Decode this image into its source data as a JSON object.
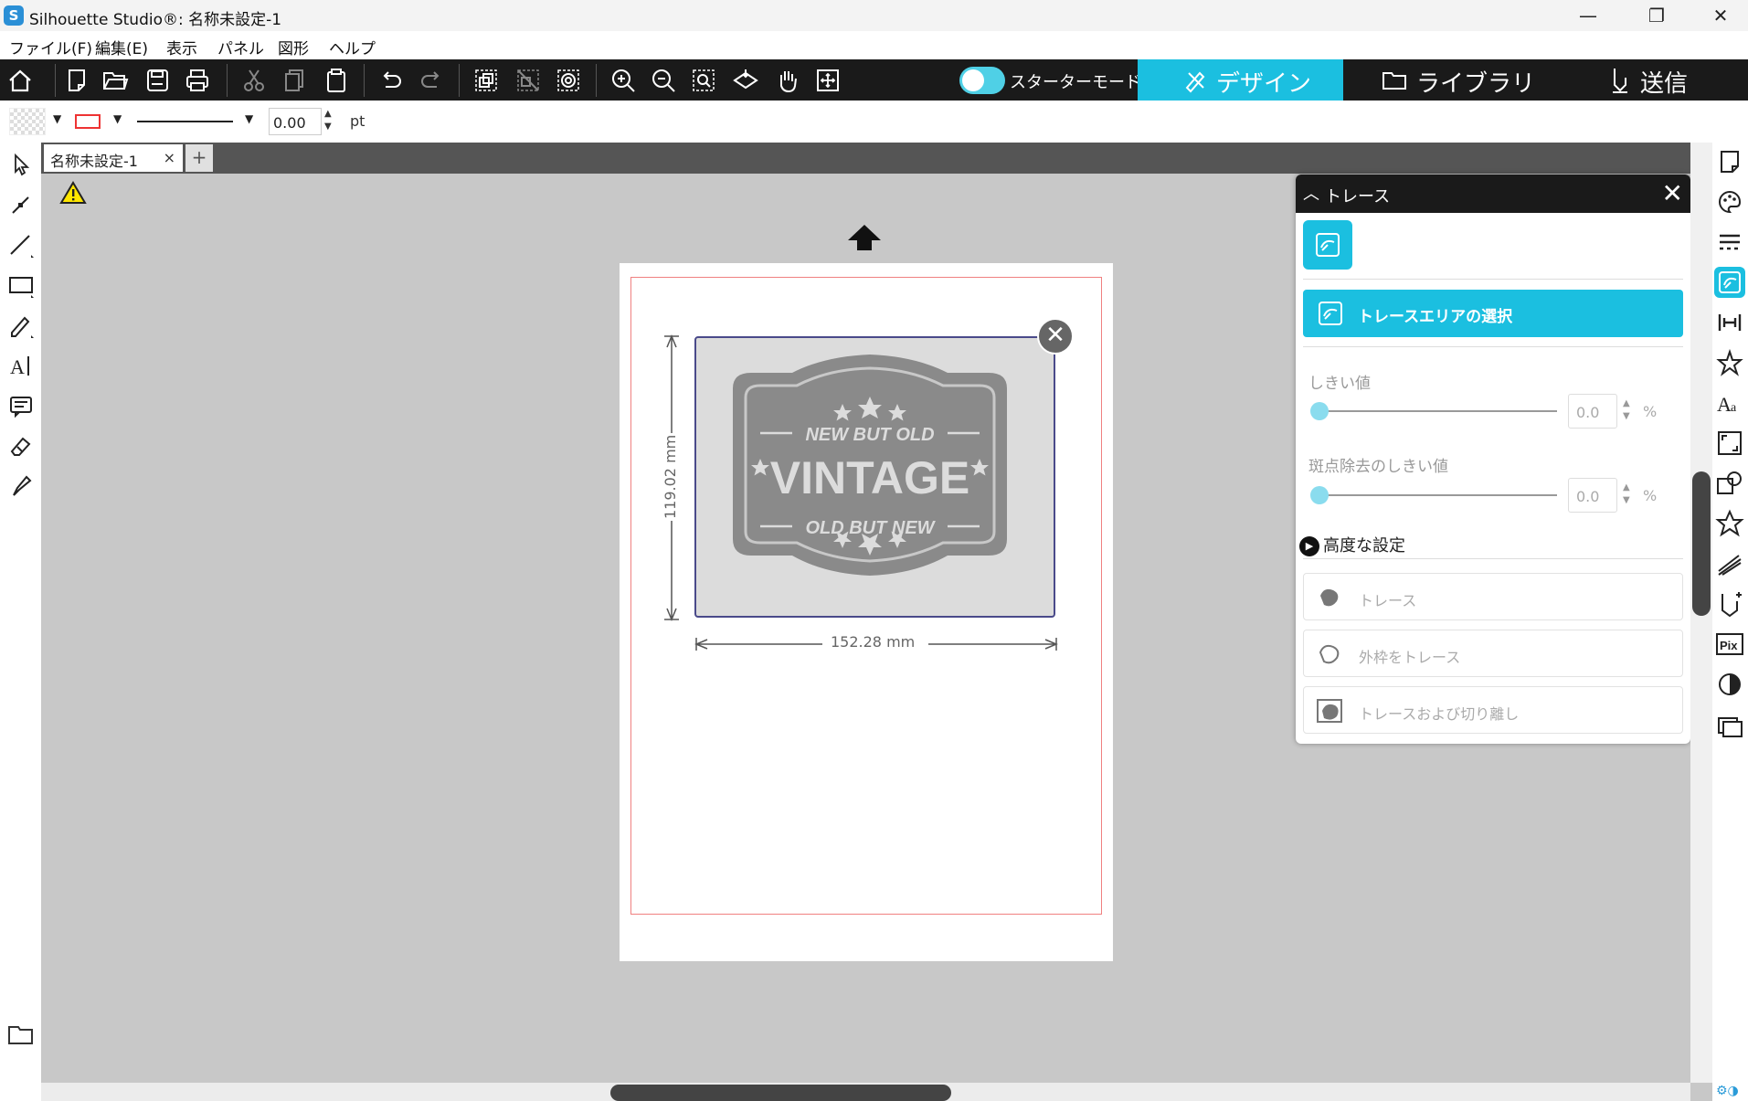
{
  "window": {
    "title": "Silhouette Studio®: 名称未設定-1",
    "minimize": "—",
    "restore": "❐",
    "close": "✕"
  },
  "menu": [
    "ファイル(F)",
    "編集(E)",
    "表示",
    "パネル",
    "図形",
    "ヘルプ"
  ],
  "toolbar": {
    "starter_mode_label": "スターターモードオフ",
    "tabs": {
      "design": "デザイン",
      "library": "ライブラリ",
      "send": "送信"
    },
    "active_tab": "design",
    "accent": "#1bbfe0"
  },
  "properties": {
    "line_width": "0.00",
    "line_unit": "pt",
    "line_color": "#e33333"
  },
  "document_tabs": [
    {
      "name": "名称未設定-1",
      "close": "×"
    }
  ],
  "add_tab": "+",
  "canvas": {
    "selection": {
      "height_label": "119.02 mm",
      "width_label": "152.28 mm",
      "badge_lines": [
        "NEW BUT OLD",
        "VINTAGE",
        "OLD BUT NEW"
      ]
    }
  },
  "trace_panel": {
    "title": "トレース",
    "select_area_button": "トレースエリアの選択",
    "threshold_label": "しきい値",
    "threshold_value": "0.0",
    "threshold_unit": "%",
    "despeckle_label": "斑点除去のしきい値",
    "despeckle_value": "0.0",
    "despeckle_unit": "%",
    "advanced_label": "高度な設定",
    "options": [
      "トレース",
      "外枠をトレース",
      "トレースおよび切り離し"
    ]
  },
  "right_panel_icons": [
    "page-setup-icon",
    "palette-icon",
    "line-style-icon",
    "trace-icon",
    "align-icon",
    "transform-icon",
    "text-style-icon",
    "scale-icon",
    "replicate-icon",
    "star-icon",
    "sketch-icon",
    "offset-icon",
    "pix-icon",
    "contrast-icon",
    "layers-icon"
  ]
}
